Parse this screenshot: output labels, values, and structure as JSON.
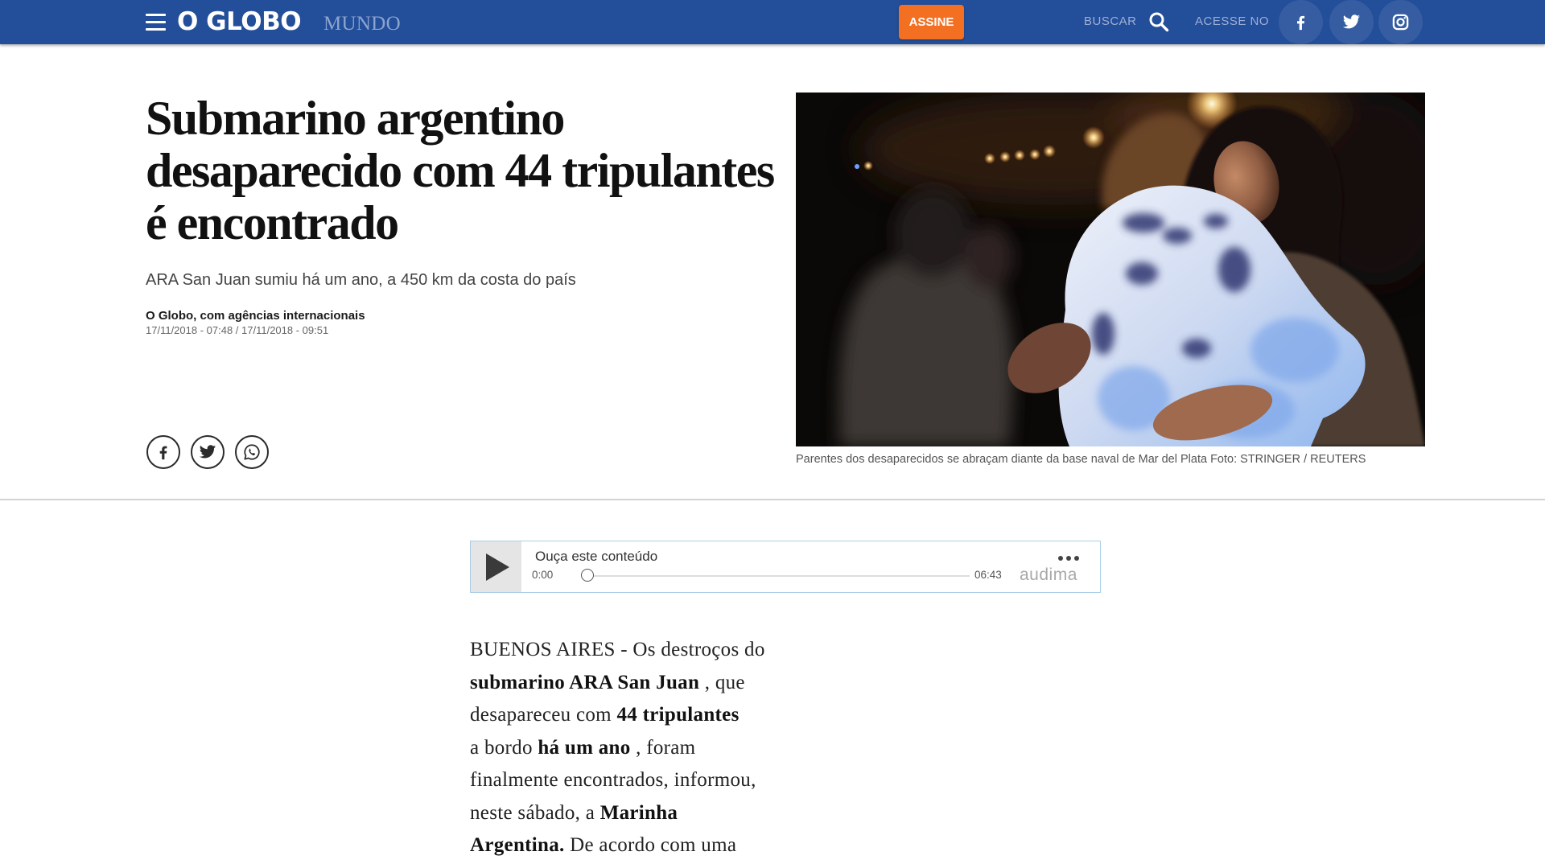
{
  "header": {
    "logo": "O GLOBO",
    "section": "MUNDO",
    "subscribe_label": "ASSINE",
    "search_label": "BUSCAR",
    "access_label": "ACESSE NO",
    "icons": [
      "menu-icon",
      "search-icon",
      "facebook-icon",
      "twitter-icon",
      "instagram-icon"
    ]
  },
  "article": {
    "headline_lines": [
      "Submarino argentino",
      "desaparecido com 44 tripulantes",
      "é encontrado"
    ],
    "subtitle": "ARA San Juan sumiu há um ano, a 450 km da costa do país",
    "byline": "O Globo, com agências internacionais",
    "dates": "17/11/2018 - 07:48 / 17/11/2018 - 09:51",
    "share_icons": [
      "facebook-icon",
      "twitter-icon",
      "whatsapp-icon"
    ],
    "photo_caption": "Parentes dos desaparecidos se abraçam diante da base naval de Mar del Plata",
    "photo_credit": "Foto: STRINGER / REUTERS",
    "body_lines": [
      [
        {
          "text": "BUENOS AIRES - Os destroços do",
          "bold": false
        }
      ],
      [
        {
          "text": "submarino ARA San Juan",
          "bold": true
        },
        {
          "text": " , que",
          "bold": false
        }
      ],
      [
        {
          "text": "desapareceu com ",
          "bold": false
        },
        {
          "text": "44 tripulantes",
          "bold": true
        }
      ],
      [
        {
          "text": "a bordo ",
          "bold": false
        },
        {
          "text": "há um ano",
          "bold": true
        },
        {
          "text": " , foram",
          "bold": false
        }
      ],
      [
        {
          "text": "finalmente encontrados, informou,",
          "bold": false
        }
      ],
      [
        {
          "text": "neste sábado, a ",
          "bold": false
        },
        {
          "text": "Marinha",
          "bold": true
        }
      ],
      [
        {
          "text": "Argentina.",
          "bold": true
        },
        {
          "text": " De acordo com uma",
          "bold": false
        }
      ]
    ]
  },
  "audio_player": {
    "title": "Ouça este conteúdo",
    "current_time": "0:00",
    "duration": "06:43",
    "brand": "audima",
    "progress": 0,
    "icons": [
      "play-icon",
      "more-options-icon"
    ]
  },
  "colors": {
    "header_bg": "#234e99",
    "subscribe_bg": "#f36f21",
    "player_border": "#a9cfe6"
  }
}
